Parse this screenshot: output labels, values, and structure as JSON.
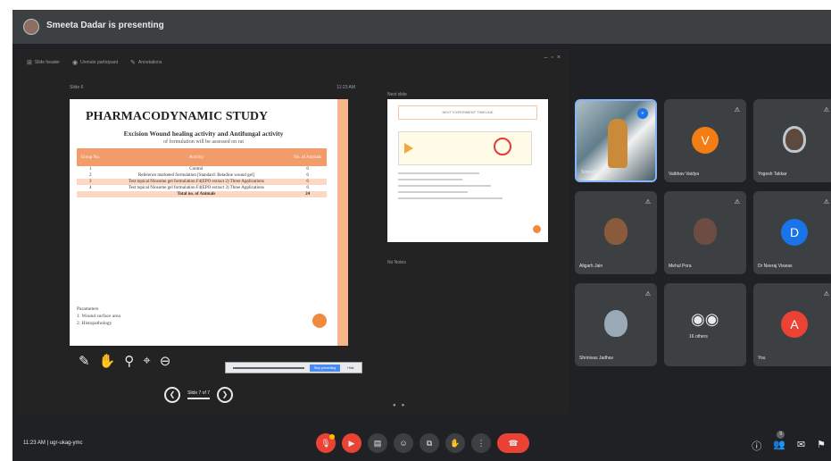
{
  "banner": {
    "title": "Smeeta Dadar is presenting"
  },
  "presentation": {
    "toolbar": [
      "Slide header",
      "Unmute participant",
      "Annotations"
    ],
    "slide_header_left": "Slide 6",
    "slide_header_right": "11:23 AM",
    "slide": {
      "title": "PHARMACODYNAMIC STUDY",
      "subtitle": "Excision Wound healing activity and Antifungal activity",
      "subtitle2": "of formulation will be assessed on rat",
      "table_headers": [
        "Group No.",
        "Activity",
        "No. of Animals"
      ],
      "rows": [
        {
          "group": "1",
          "activity": "Control",
          "animals": "6"
        },
        {
          "group": "2",
          "activity": "Reference marketed formulation [Standard: Betadine wound gel]",
          "animals": "6"
        },
        {
          "group": "3",
          "activity": "Test topical Niosome gel formulation F4(EPO extract 2) Three Applications",
          "animals": "6"
        },
        {
          "group": "4",
          "activity": "Test topical Niosome gel formulation F4(EPO extract 3) Three Applications",
          "animals": "6"
        }
      ],
      "total_label": "Total no. of Animals",
      "total_value": "24",
      "parameters_title": "Parameters",
      "parameters": [
        "1. Wound surface area",
        "2. Histopathology"
      ]
    },
    "next_label": "Next slide",
    "thumb_title": "NEXT EXPERIMENT TIMELINE",
    "notes_label": "No Notes",
    "page_indicator": "Slide 7 of 7",
    "annot_icons": [
      "pen-icon",
      "hand-icon",
      "zoom-icon",
      "pointer-icon",
      "minus-icon"
    ],
    "control_btn_primary": "Stop presenting",
    "control_btn_secondary": "Hide"
  },
  "participants": [
    {
      "name": "Smeeta Dadar",
      "type": "video"
    },
    {
      "name": "Vaibhav Vaidya",
      "type": "letter",
      "letter": "V",
      "color": "#f37d15"
    },
    {
      "name": "Yogesh Takkar",
      "type": "photo"
    },
    {
      "name": "Aligarh Jain",
      "type": "photo"
    },
    {
      "name": "Mehul Pora",
      "type": "photo"
    },
    {
      "name": "Dr Neeraj Viswas",
      "type": "letter",
      "letter": "D",
      "color": "#1a73e8"
    },
    {
      "name": "Shrinivas Jadhav",
      "type": "photo"
    },
    {
      "name": "16 others",
      "type": "others"
    },
    {
      "name": "You",
      "type": "letter",
      "letter": "A",
      "color": "#ea4335"
    }
  ],
  "bottom": {
    "time": "11:23 AM",
    "separator": "|",
    "meeting_code": "ugr-ukag-ymc",
    "right_badge": "9"
  }
}
